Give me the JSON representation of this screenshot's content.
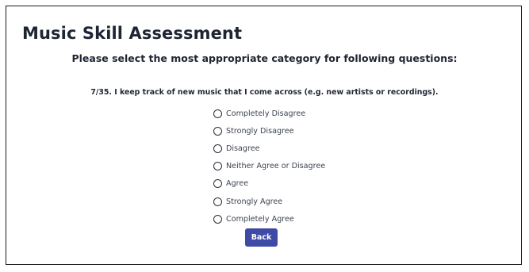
{
  "app": {
    "title": "Music Skill Assessment"
  },
  "instructions": "Please select the most appropriate category for following questions:",
  "question": {
    "text": "7/35. I keep track of new music that I come across (e.g. new artists or recordings)."
  },
  "options": [
    {
      "label": "Completely Disagree",
      "selected": false
    },
    {
      "label": "Strongly Disagree",
      "selected": false
    },
    {
      "label": "Disagree",
      "selected": false
    },
    {
      "label": "Neither Agree or Disagree",
      "selected": false
    },
    {
      "label": "Agree",
      "selected": false
    },
    {
      "label": "Strongly Agree",
      "selected": false
    },
    {
      "label": "Completely Agree",
      "selected": false
    }
  ],
  "buttons": {
    "back_label": "Back"
  },
  "colors": {
    "button_background": "#3f4aa6",
    "button_text": "#ffffff",
    "title_text": "#1d2433",
    "border": "#1a1a1a"
  }
}
